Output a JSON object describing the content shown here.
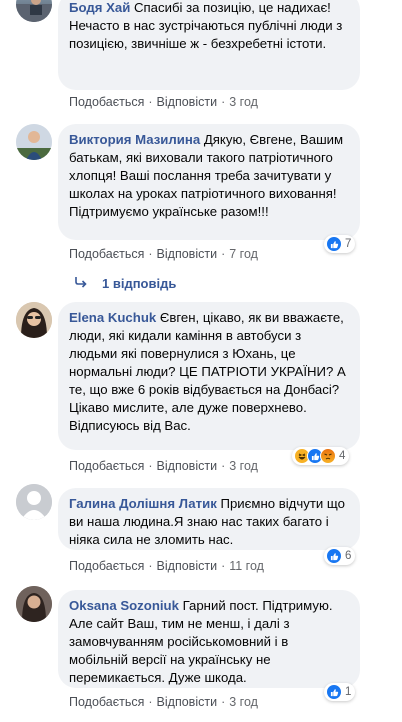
{
  "labels": {
    "like": "Подобається",
    "reply": "Відповісти",
    "separator": "·"
  },
  "comments": [
    {
      "author": "Бодя Хай",
      "text_first": "Спасибі за позицію, це надихає!",
      "text_rest": "Нечасто в нас зустрічаються публічні люди з позицією, звичніше ж - безхребетні істоти.",
      "time": "3 год"
    },
    {
      "author": "Виктория Мазилина",
      "text": "Дякую, Євгене, Вашим батькам, які виховали такого патріотичного хлопця! Ваші послання треба зачитувати у школах на уроках патріотичного виховання! Підтримуємо українське разом!!!",
      "time": "7 год",
      "reactions": {
        "count": "7",
        "icons": [
          "like-icon"
        ]
      }
    },
    {
      "author": "Elena Kuchuk",
      "text": "Євген, цікаво, як ви вважаєте, люди, які кидали каміння в автобуси з людьми які повернулися з Юхань, це нормальні люди? ЦЕ ПАТРІОТИ УКРАЇНИ? А те, що вже 6 років відбувається на Донбасі? Цікаво мислите, але дуже поверхнево. Відписуюсь від Вас.",
      "time": "3 год",
      "reactions": {
        "count": "4",
        "icons": [
          "haha-icon",
          "like-icon",
          "angry-icon"
        ]
      }
    },
    {
      "author": "Галина Долішня Латик",
      "text": "Приємно відчути що ви наша людина.Я знаю нас таких багато і ніяка сила не зломить нас.",
      "time": "11 год",
      "reactions": {
        "count": "6",
        "icons": [
          "like-icon"
        ]
      }
    },
    {
      "author": "Oksana Sozoniuk",
      "text": "Гарний пост. Підтримую. Але сайт Ваш, тим не менш, і далі з замовчуванням російськомовний і в мобільній версії на українську не перемикається. Дуже шкода.",
      "time": "3 год",
      "reactions": {
        "count": "1",
        "icons": [
          "like-icon"
        ]
      }
    }
  ],
  "replies_link": {
    "label": "1 відповідь"
  },
  "colors": {
    "author": "#385898",
    "bubble": "#f0f2f5",
    "like_blue": "#1877f2",
    "haha_yellow": "#f7b125",
    "angry_red": "#e9710f"
  }
}
